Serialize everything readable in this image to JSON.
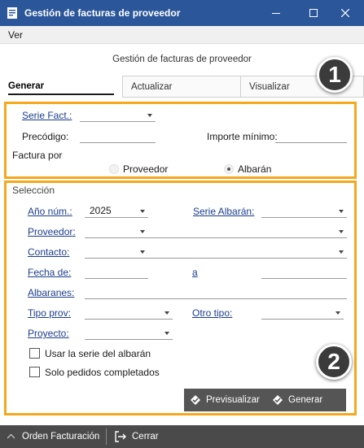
{
  "window": {
    "title": "Gestión de facturas de proveedor"
  },
  "menu": {
    "items": [
      "Ver"
    ]
  },
  "form_title": "Gestión de facturas de proveedor",
  "tabs": [
    {
      "label": "Generar",
      "active": true
    },
    {
      "label": "Actualizar",
      "active": false
    },
    {
      "label": "Visualizar",
      "active": false
    }
  ],
  "badges": {
    "one": "1",
    "two": "2"
  },
  "header_section": {
    "serie_fact_label": "Serie Fact.:",
    "serie_fact_value": "",
    "precodigo_label": "Precódigo:",
    "precodigo_value": "",
    "importe_minimo_label": "Importe mínimo:",
    "importe_minimo_value": "",
    "factura_por_label": "Factura por",
    "factura_por_options": [
      {
        "label": "Proveedor",
        "selected": false
      },
      {
        "label": "Albarán",
        "selected": true
      }
    ]
  },
  "seleccion": {
    "title": "Selección",
    "ano_num_label": "Año núm.:",
    "ano_num_value": "2025",
    "serie_albaran_label": "Serie Albarán:",
    "proveedor_label": "Proveedor:",
    "contacto_label": "Contacto:",
    "fecha_de_label": "Fecha de:",
    "fecha_a_label": "a",
    "albaranes_label": "Albaranes:",
    "tipo_prov_label": "Tipo prov:",
    "otro_tipo_label": "Otro tipo:",
    "proyecto_label": "Proyecto:",
    "usar_serie_label": "Usar la serie del albarán",
    "usar_serie_checked": false,
    "solo_pedidos_label": "Solo pedidos completados",
    "solo_pedidos_checked": false,
    "previsualizar_label": "Previsualizar",
    "generar_label": "Generar"
  },
  "bottom": {
    "orden_facturacion_label": "Orden Facturación",
    "cerrar_label": "Cerrar"
  },
  "colors": {
    "titlebar": "#2b579a",
    "highlight": "#f5a81c",
    "link": "#1b3d8f",
    "button_bar": "#555555",
    "bottom_bar": "#4a4a4a"
  }
}
